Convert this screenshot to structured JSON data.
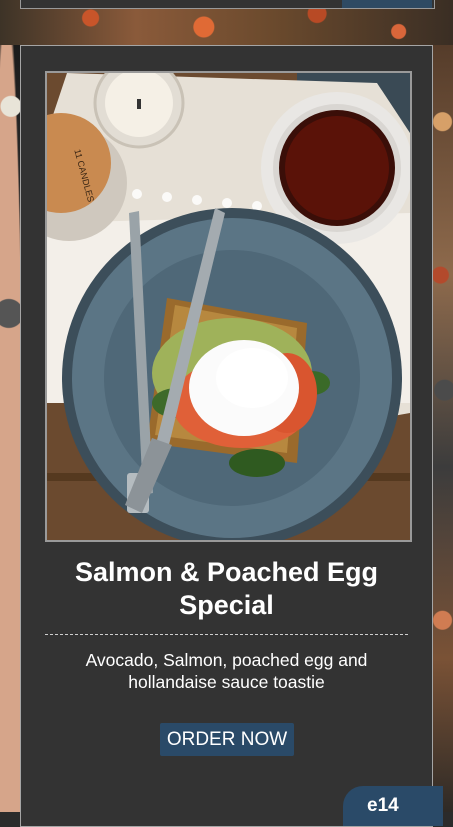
{
  "product": {
    "title_line1": "Salmon & Poached Egg",
    "title_line2": "Special",
    "description_line1": "Avocado, Salmon, poached egg and",
    "description_line2": "hollandaise sauce toastie",
    "order_label": "ORDER NOW",
    "price": "e14",
    "candle_label": "11 CANDLES"
  },
  "colors": {
    "card_background": "#333333",
    "accent": "#2a4a68",
    "text": "#ffffff"
  },
  "icons": {
    "photo": "food-photo"
  }
}
